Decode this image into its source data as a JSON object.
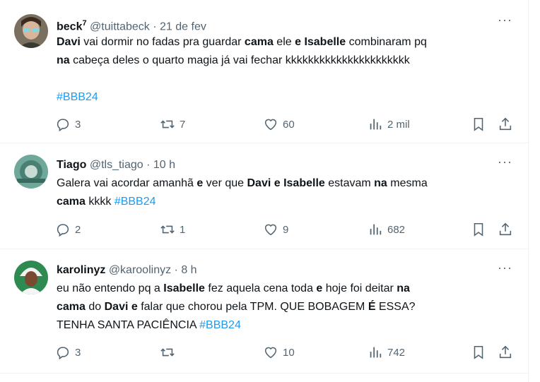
{
  "tweets": [
    {
      "name": "beck",
      "badge": "7",
      "handle": "@tuittabeck",
      "sep": "·",
      "time": "21 de fev",
      "more": "···",
      "text_parts": [
        {
          "b": true,
          "t": "Davi"
        },
        {
          "t": " vai dormir no fadas pra guardar "
        },
        {
          "b": true,
          "t": "cama"
        },
        {
          "t": " ele "
        },
        {
          "b": true,
          "t": "e Isabelle"
        },
        {
          "t": " combinaram pq\n"
        },
        {
          "b": true,
          "t": "na"
        },
        {
          "t": " cabeça deles o quarto magia já vai fechar kkkkkkkkkkkkkkkkkkkkkk\n\n"
        },
        {
          "tag": true,
          "t": "#BBB24"
        }
      ],
      "replies": "3",
      "retweets": "7",
      "likes": "60",
      "views": "2 mil",
      "avatar_color": "#5a5a4a"
    },
    {
      "name": "Tiago",
      "badge": "",
      "handle": "@tls_tiago",
      "sep": "·",
      "time": "10 h",
      "more": "···",
      "text_parts": [
        {
          "t": "Galera vai acordar amanhã "
        },
        {
          "b": true,
          "t": "e"
        },
        {
          "t": " ver que "
        },
        {
          "b": true,
          "t": "Davi e Isabelle"
        },
        {
          "t": " estavam "
        },
        {
          "b": true,
          "t": "na"
        },
        {
          "t": " mesma\n"
        },
        {
          "b": true,
          "t": "cama"
        },
        {
          "t": " kkkk "
        },
        {
          "tag": true,
          "t": "#BBB24"
        }
      ],
      "replies": "2",
      "retweets": "1",
      "likes": "9",
      "views": "682",
      "avatar_color": "#4a8a7a"
    },
    {
      "name": "karolinyz",
      "badge": "",
      "handle": "@karoolinyz",
      "sep": "·",
      "time": "8 h",
      "more": "···",
      "text_parts": [
        {
          "t": "eu não entendo pq a "
        },
        {
          "b": true,
          "t": "Isabelle"
        },
        {
          "t": " fez  aquela cena toda "
        },
        {
          "b": true,
          "t": "e"
        },
        {
          "t": " hoje foi deitar "
        },
        {
          "b": true,
          "t": "na\ncama"
        },
        {
          "t": " do "
        },
        {
          "b": true,
          "t": "Davi e"
        },
        {
          "t": " falar que chorou pela TPM. QUE BOBAGEM "
        },
        {
          "b": true,
          "t": "É"
        },
        {
          "t": " ESSA?\nTENHA SANTA PACIÊNCIA "
        },
        {
          "tag": true,
          "t": "#BBB24"
        }
      ],
      "replies": "3",
      "retweets": "",
      "likes": "10",
      "views": "742",
      "avatar_color": "#2a7a4a"
    }
  ]
}
